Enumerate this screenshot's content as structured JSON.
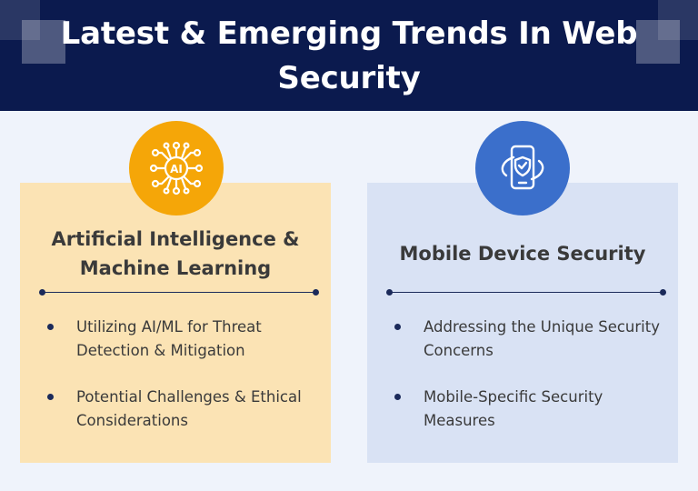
{
  "header": {
    "title": "Latest & Emerging Trends In Web Security",
    "background": "#0b1a4e"
  },
  "cards": [
    {
      "icon": "ai-circuit-icon",
      "badge_color": "#f5a608",
      "card_color": "#fbe3b4",
      "icon_text": "AI",
      "title": "Artificial Intelligence & Machine Learning",
      "bullets": [
        "Utilizing AI/ML for Threat Detection & Mitigation",
        "Potential Challenges & Ethical Considerations"
      ]
    },
    {
      "icon": "mobile-shield-icon",
      "badge_color": "#3b6fcb",
      "card_color": "#d9e2f4",
      "title": "Mobile Device Security",
      "bullets": [
        "Addressing the Unique Security Concerns",
        "Mobile-Specific Security Measures"
      ]
    }
  ]
}
